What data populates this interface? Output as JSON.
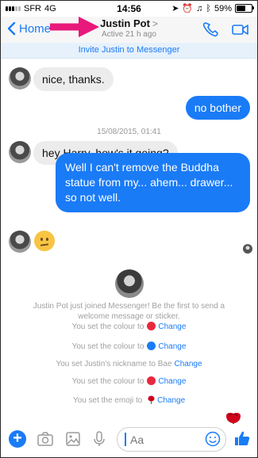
{
  "status_bar": {
    "carrier": "SFR",
    "network": "4G",
    "time": "14:56",
    "battery": "59%"
  },
  "header": {
    "back_label": "Home",
    "contact_name": "Justin Pot",
    "chevron": ">",
    "active_status": "Active 21 h ago",
    "call_icon": "phone-icon",
    "video_icon": "video-camera-icon"
  },
  "banner": {
    "invite_text": "Invite Justin to Messenger"
  },
  "messages": [
    {
      "direction": "in",
      "text": "nice, thanks."
    },
    {
      "direction": "out",
      "text": "no bother"
    },
    {
      "direction": "timestamp",
      "text": "15/08/2015, 01:41"
    },
    {
      "direction": "in",
      "text": "hey Harry, how's it going?"
    },
    {
      "direction": "out",
      "text": "Well I can't remove the Buddha statue from my... ahem... drawer... so not well."
    },
    {
      "direction": "in",
      "text": "",
      "emoji": "confused-face"
    }
  ],
  "system_messages": {
    "joined": "Justin Pot just joined Messenger! Be the first to send a welcome message or sticker.",
    "colour_1": "You set the colour to",
    "colour_2": "You set the colour to",
    "nickname": "You set Justin's nickname to Bae",
    "colour_3": "You set the colour to",
    "emoji": "You set the emoji to",
    "change_label": "Change"
  },
  "colors": {
    "accent": "#1a7bf6",
    "colour_1": "#e9283e",
    "colour_2": "#1a7bf6",
    "colour_3": "#e9283e",
    "rose": "#d0021b"
  },
  "composer": {
    "placeholder": "Aa",
    "icons": [
      "plus-icon",
      "camera-icon",
      "gallery-icon",
      "microphone-icon",
      "smiley-icon",
      "thumbs-up-icon"
    ]
  }
}
